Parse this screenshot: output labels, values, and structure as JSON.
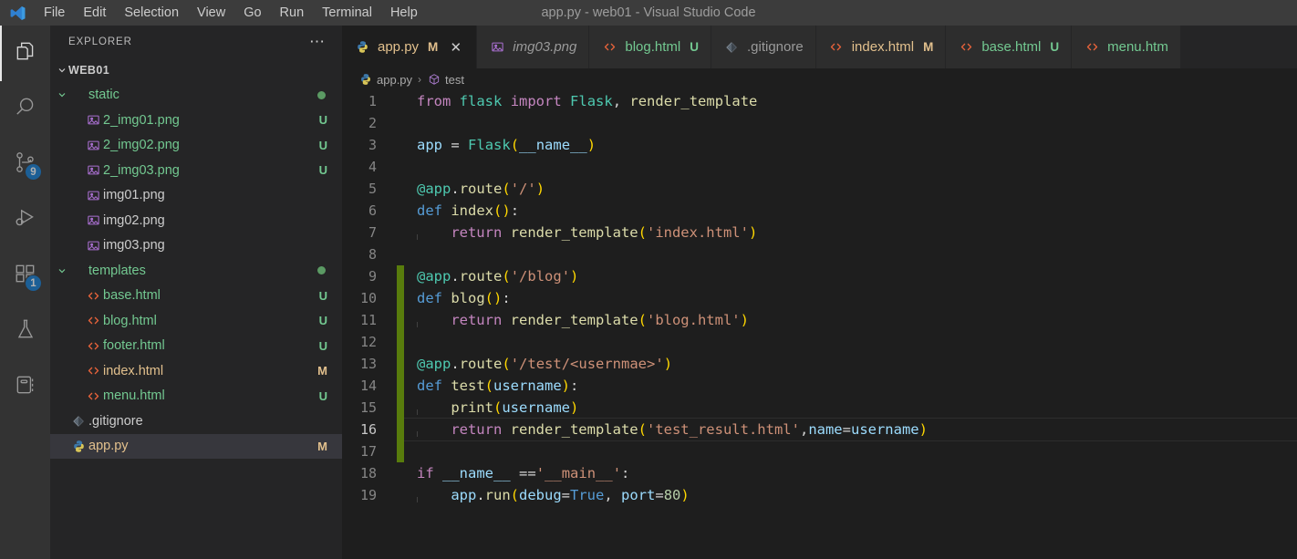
{
  "titlebar": {
    "title": "app.py - web01 - Visual Studio Code",
    "logo_icon": "vscode-logo-icon",
    "menu": [
      {
        "label": "File"
      },
      {
        "label": "Edit"
      },
      {
        "label": "Selection"
      },
      {
        "label": "View"
      },
      {
        "label": "Go"
      },
      {
        "label": "Run"
      },
      {
        "label": "Terminal"
      },
      {
        "label": "Help"
      }
    ]
  },
  "activitybar": {
    "items": [
      {
        "name": "explorer",
        "icon": "files-icon",
        "active": true,
        "badge": ""
      },
      {
        "name": "search",
        "icon": "search-icon",
        "active": false,
        "badge": ""
      },
      {
        "name": "source-control",
        "icon": "source-control-icon",
        "active": false,
        "badge": "9"
      },
      {
        "name": "run-debug",
        "icon": "run-and-debug-icon",
        "active": false,
        "badge": ""
      },
      {
        "name": "extensions",
        "icon": "extensions-icon",
        "active": false,
        "badge": "1"
      },
      {
        "name": "testing",
        "icon": "beaker-icon",
        "active": false,
        "badge": ""
      },
      {
        "name": "database",
        "icon": "notebook-icon",
        "active": false,
        "badge": ""
      }
    ]
  },
  "sidebar": {
    "header_title": "EXPLORER",
    "more_actions_icon": "ellipsis-icon",
    "root": {
      "label": "WEB01",
      "expanded": true
    },
    "tree": [
      {
        "label": "static",
        "icon": "folder-icon",
        "indent": 1,
        "type": "folder",
        "expanded": true,
        "deco": "",
        "dot": true,
        "color": "c-green",
        "selected": false
      },
      {
        "label": "2_img01.png",
        "icon": "image-icon",
        "indent": 2,
        "type": "file",
        "deco": "U",
        "dot": false,
        "color": "c-green",
        "selected": false
      },
      {
        "label": "2_img02.png",
        "icon": "image-icon",
        "indent": 2,
        "type": "file",
        "deco": "U",
        "dot": false,
        "color": "c-green",
        "selected": false
      },
      {
        "label": "2_img03.png",
        "icon": "image-icon",
        "indent": 2,
        "type": "file",
        "deco": "U",
        "dot": false,
        "color": "c-green",
        "selected": false
      },
      {
        "label": "img01.png",
        "icon": "image-icon",
        "indent": 2,
        "type": "file",
        "deco": "",
        "dot": false,
        "color": "c-white",
        "selected": false
      },
      {
        "label": "img02.png",
        "icon": "image-icon",
        "indent": 2,
        "type": "file",
        "deco": "",
        "dot": false,
        "color": "c-white",
        "selected": false
      },
      {
        "label": "img03.png",
        "icon": "image-icon",
        "indent": 2,
        "type": "file",
        "deco": "",
        "dot": false,
        "color": "c-white",
        "selected": false
      },
      {
        "label": "templates",
        "icon": "folder-icon",
        "indent": 1,
        "type": "folder",
        "expanded": true,
        "deco": "",
        "dot": true,
        "color": "c-green",
        "selected": false
      },
      {
        "label": "base.html",
        "icon": "html-icon",
        "indent": 2,
        "type": "file",
        "deco": "U",
        "dot": false,
        "color": "c-green",
        "selected": false
      },
      {
        "label": "blog.html",
        "icon": "html-icon",
        "indent": 2,
        "type": "file",
        "deco": "U",
        "dot": false,
        "color": "c-green",
        "selected": false
      },
      {
        "label": "footer.html",
        "icon": "html-icon",
        "indent": 2,
        "type": "file",
        "deco": "U",
        "dot": false,
        "color": "c-green",
        "selected": false
      },
      {
        "label": "index.html",
        "icon": "html-icon",
        "indent": 2,
        "type": "file",
        "deco": "M",
        "dot": false,
        "color": "c-yellow",
        "selected": false
      },
      {
        "label": "menu.html",
        "icon": "html-icon",
        "indent": 2,
        "type": "file",
        "deco": "U",
        "dot": false,
        "color": "c-green",
        "selected": false
      },
      {
        "label": ".gitignore",
        "icon": "git-icon",
        "indent": 1,
        "type": "file",
        "deco": "",
        "dot": false,
        "color": "c-white",
        "selected": false
      },
      {
        "label": "app.py",
        "icon": "python-icon",
        "indent": 1,
        "type": "file",
        "deco": "M",
        "dot": false,
        "color": "c-yellow",
        "selected": true
      }
    ]
  },
  "tabs": [
    {
      "label": "app.py",
      "icon": "python-icon",
      "badge": "M",
      "active": true,
      "italic": false,
      "close_icon": "close-icon",
      "color": "c-yellow"
    },
    {
      "label": "img03.png",
      "icon": "image-icon",
      "badge": "",
      "active": false,
      "italic": true,
      "close_icon": "",
      "color": ""
    },
    {
      "label": "blog.html",
      "icon": "html-icon",
      "badge": "U",
      "active": false,
      "italic": false,
      "close_icon": "",
      "color": "c-green"
    },
    {
      "label": ".gitignore",
      "icon": "git-icon",
      "badge": "",
      "active": false,
      "italic": false,
      "close_icon": "",
      "color": ""
    },
    {
      "label": "index.html",
      "icon": "html-icon",
      "badge": "M",
      "active": false,
      "italic": false,
      "close_icon": "",
      "color": "c-yellow"
    },
    {
      "label": "base.html",
      "icon": "html-icon",
      "badge": "U",
      "active": false,
      "italic": false,
      "close_icon": "",
      "color": "c-green"
    },
    {
      "label": "menu.htm",
      "icon": "html-icon",
      "badge": "",
      "active": false,
      "italic": false,
      "close_icon": "",
      "color": "c-green"
    }
  ],
  "breadcrumb": {
    "file": "app.py",
    "file_icon": "python-icon",
    "separator": "›",
    "symbol": "test",
    "symbol_icon": "symbol-method-icon"
  },
  "editor": {
    "language": "python",
    "lines": [
      {
        "n": "1",
        "added": false,
        "current": false
      },
      {
        "n": "2",
        "added": false,
        "current": false
      },
      {
        "n": "3",
        "added": false,
        "current": false
      },
      {
        "n": "4",
        "added": false,
        "current": false
      },
      {
        "n": "5",
        "added": false,
        "current": false
      },
      {
        "n": "6",
        "added": false,
        "current": false
      },
      {
        "n": "7",
        "added": false,
        "current": false
      },
      {
        "n": "8",
        "added": false,
        "current": false
      },
      {
        "n": "9",
        "added": true,
        "current": false
      },
      {
        "n": "10",
        "added": true,
        "current": false
      },
      {
        "n": "11",
        "added": true,
        "current": false
      },
      {
        "n": "12",
        "added": true,
        "current": false
      },
      {
        "n": "13",
        "added": true,
        "current": false
      },
      {
        "n": "14",
        "added": true,
        "current": false
      },
      {
        "n": "15",
        "added": true,
        "current": false
      },
      {
        "n": "16",
        "added": true,
        "current": true
      },
      {
        "n": "17",
        "added": true,
        "current": false
      },
      {
        "n": "18",
        "added": false,
        "current": false
      },
      {
        "n": "19",
        "added": false,
        "current": false
      }
    ],
    "source_text": [
      "from flask import Flask, render_template",
      "",
      "app = Flask(__name__)",
      "",
      "@app.route('/')",
      "def index():",
      "    return render_template('index.html')",
      "",
      "@app.route('/blog')",
      "def blog():",
      "    return render_template('blog.html')",
      "",
      "@app.route('/test/<usernmae>')",
      "def test(username):",
      "    print(username)",
      "    return render_template('test_result.html',name=username)",
      "",
      "if __name__ =='__main__':",
      "    app.run(debug=True, port=80)"
    ]
  },
  "colors": {
    "titlebar_bg": "#3c3c3c",
    "activitybar_bg": "#333333",
    "sidebar_bg": "#252526",
    "editor_bg": "#1e1e1e",
    "tab_inactive_bg": "#2d2d2d",
    "badge_bg": "#0e7ad4",
    "git_added_gutter": "#587c0c",
    "untracked_green": "#73c991",
    "modified_yellow": "#e2c08d"
  }
}
